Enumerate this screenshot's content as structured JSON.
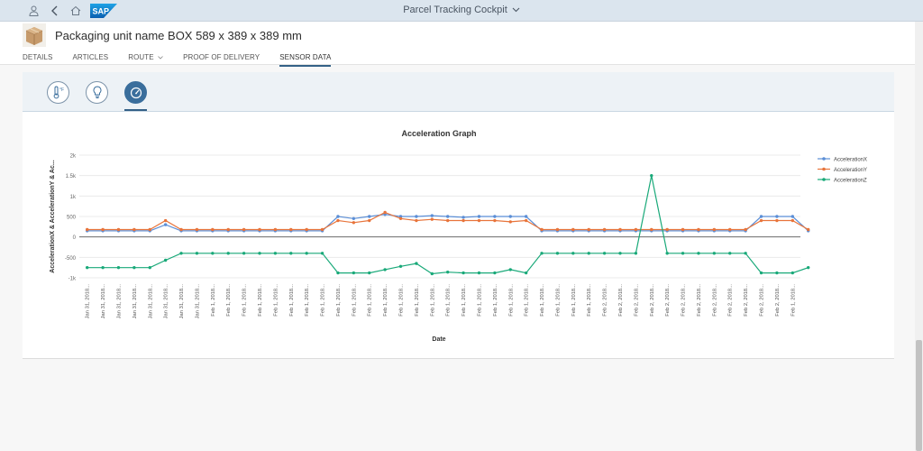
{
  "shell": {
    "title": "Parcel Tracking Cockpit",
    "icons": [
      "user-icon",
      "back-icon",
      "home-icon",
      "chevron-down-icon"
    ],
    "logo_text": "SAP"
  },
  "object": {
    "title": "Packaging unit name BOX 589 x 389 x 389 mm"
  },
  "tabs": [
    {
      "label": "DETAILS",
      "active": false
    },
    {
      "label": "ARTICLES",
      "active": false
    },
    {
      "label": "ROUTE",
      "active": false,
      "dropdown": true
    },
    {
      "label": "PROOF OF DELIVERY",
      "active": false
    },
    {
      "label": "SENSOR DATA",
      "active": true
    }
  ],
  "sensor_tabs": [
    {
      "name": "temperature-icon",
      "selected": false
    },
    {
      "name": "lightbulb-icon",
      "selected": false
    },
    {
      "name": "gauge-icon",
      "selected": true
    }
  ],
  "colors": {
    "accelerationX": "#5b8ed6",
    "accelerationY": "#e8743b",
    "accelerationZ": "#19a979",
    "accent": "#346187"
  },
  "chart_data": {
    "type": "line",
    "title": "Acceleration Graph",
    "xlabel": "Date",
    "ylabel": "AccelerationX & AccelerationY & Ac...",
    "ylim": [
      -1000,
      2000
    ],
    "yticks": [
      "2k",
      "1.5k",
      "1k",
      "500",
      "0",
      "-500",
      "-1k"
    ],
    "grid": true,
    "legend_position": "top-right",
    "categories": [
      "Jan 31, 2018...",
      "Jan 31, 2018...",
      "Jan 31, 2018...",
      "Jan 31, 2018...",
      "Jan 31, 2018...",
      "Jan 31, 2018...",
      "Jan 31, 2018...",
      "Jan 31, 2018...",
      "Feb 1, 2018...",
      "Feb 1, 2018...",
      "Feb 1, 2018...",
      "Feb 1, 2018...",
      "Feb 1, 2018...",
      "Feb 1, 2018...",
      "Feb 1, 2018...",
      "Feb 1, 2018...",
      "Feb 1, 2018...",
      "Feb 1, 2018...",
      "Feb 1, 2018...",
      "Feb 1, 2018...",
      "Feb 1, 2018...",
      "Feb 1, 2018...",
      "Feb 1, 2018...",
      "Feb 1, 2018...",
      "Feb 1, 2018...",
      "Feb 1, 2018...",
      "Feb 1, 2018...",
      "Feb 1, 2018...",
      "Feb 1, 2018...",
      "Feb 1, 2018...",
      "Feb 1, 2018...",
      "Feb 1, 2018...",
      "Feb 1, 2018...",
      "Feb 2, 2018...",
      "Feb 2, 2018...",
      "Feb 2, 2018...",
      "Feb 2, 2018...",
      "Feb 2, 2018...",
      "Feb 2, 2018...",
      "Feb 2, 2018...",
      "Feb 2, 2018...",
      "Feb 2, 2018...",
      "Feb 2, 2018...",
      "Feb 2, 2018...",
      "Feb 2, 2018...",
      "Feb 1, 2018..."
    ],
    "series": [
      {
        "name": "AccelerationX",
        "values": [
          150,
          150,
          150,
          150,
          150,
          300,
          150,
          150,
          150,
          150,
          150,
          150,
          150,
          150,
          150,
          150,
          500,
          450,
          500,
          550,
          500,
          500,
          520,
          500,
          480,
          500,
          500,
          500,
          500,
          150,
          150,
          150,
          150,
          150,
          150,
          150,
          150,
          150,
          150,
          150,
          150,
          150,
          150,
          500,
          500,
          500,
          150
        ]
      },
      {
        "name": "AccelerationY",
        "values": [
          180,
          180,
          180,
          180,
          180,
          400,
          180,
          180,
          180,
          180,
          180,
          180,
          180,
          180,
          180,
          180,
          400,
          350,
          400,
          600,
          450,
          400,
          430,
          400,
          400,
          400,
          400,
          370,
          400,
          180,
          180,
          180,
          180,
          180,
          180,
          180,
          180,
          180,
          180,
          180,
          180,
          180,
          180,
          400,
          400,
          400,
          180
        ]
      },
      {
        "name": "AccelerationZ",
        "values": [
          -750,
          -750,
          -750,
          -750,
          -750,
          -570,
          -400,
          -400,
          -400,
          -400,
          -400,
          -400,
          -400,
          -400,
          -400,
          -400,
          -880,
          -880,
          -880,
          -800,
          -720,
          -650,
          -900,
          -860,
          -880,
          -880,
          -880,
          -800,
          -880,
          -400,
          -400,
          -400,
          -400,
          -400,
          -400,
          -400,
          1500,
          -400,
          -400,
          -400,
          -400,
          -400,
          -400,
          -880,
          -880,
          -880,
          -750
        ]
      }
    ]
  }
}
